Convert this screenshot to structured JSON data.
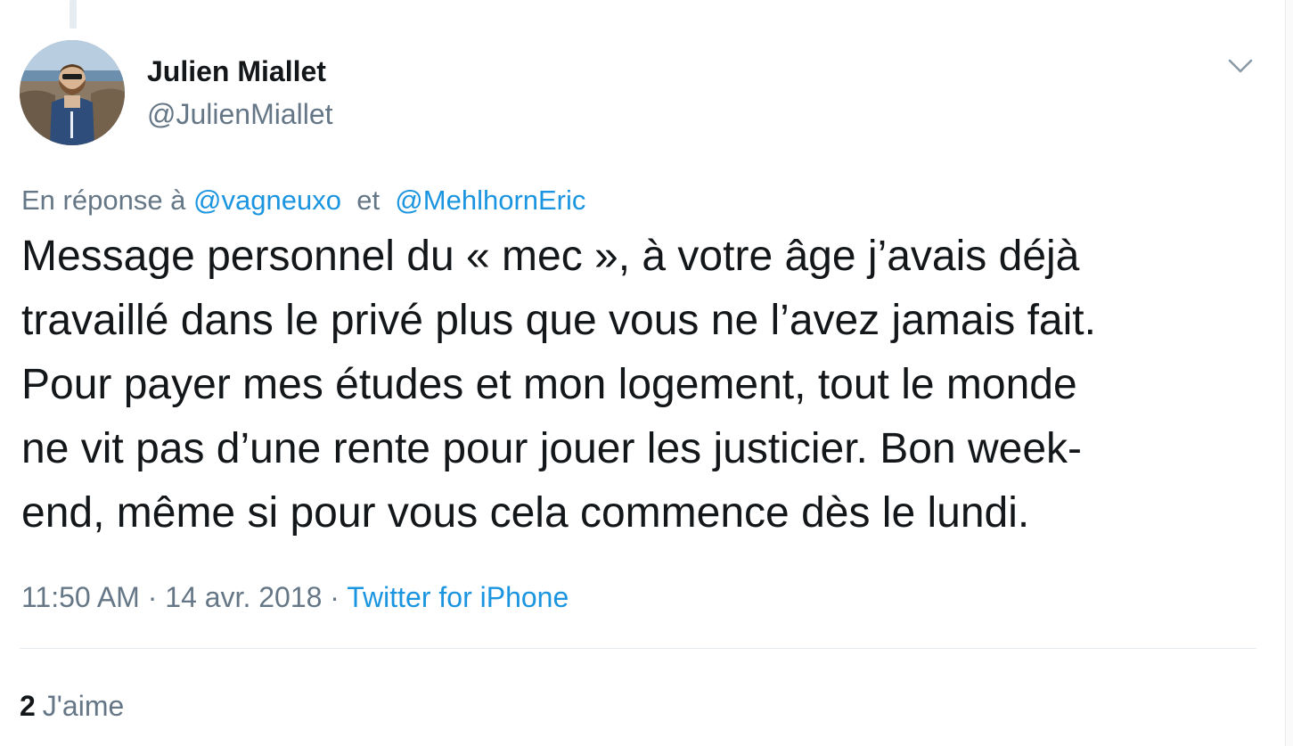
{
  "tweet": {
    "author_name": "Julien Miallet",
    "author_handle": "@JulienMiallet",
    "reply_prefix": "En réponse à",
    "reply_users": [
      "@vagneuxo",
      "@MehlhornEric"
    ],
    "reply_conjunction": "et",
    "text_lines": [
      "Message personnel du « mec », à votre âge j’avais déjà",
      "travaillé dans le privé plus que vous ne l’avez jamais fait.",
      "Pour payer mes études et mon logement, tout le monde",
      "ne vit pas d’une rente pour jouer les justicier. Bon week-",
      "end, même si pour vous cela commence dès le lundi."
    ],
    "time": "11:50 AM",
    "separator": "·",
    "date": "14 avr. 2018",
    "source": "Twitter for iPhone",
    "likes_count": "2",
    "likes_label": "J'aime"
  },
  "icons": {
    "menu": "chevron-down-icon",
    "avatar": "profile-photo"
  },
  "colors": {
    "text": "#14171a",
    "secondary": "#657786",
    "link": "#1b95e0",
    "divider": "#e6ecf0"
  }
}
